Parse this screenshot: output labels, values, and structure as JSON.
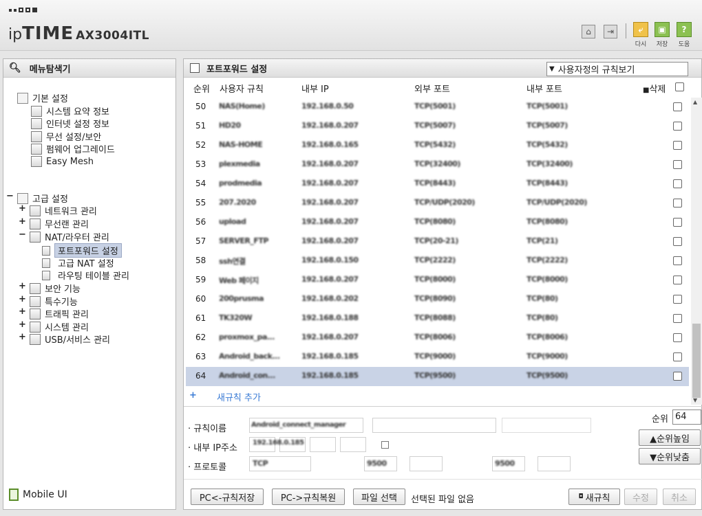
{
  "header": {
    "brand_ip": "ip",
    "brand_time": "TIME",
    "model": "AX3004ITL",
    "actions": [
      {
        "label": "다시",
        "icon": "restart-icon",
        "color": "#e0a020"
      },
      {
        "label": "저장",
        "icon": "save-icon",
        "color": "#6aa82f"
      },
      {
        "label": "도움",
        "icon": "help-icon",
        "color": "#6aa82f"
      }
    ],
    "help_glyph": "?"
  },
  "sidebar": {
    "title": "메뉴탐색기",
    "groups": [
      {
        "label": "기본 설정",
        "items": [
          "시스템 요약 정보",
          "인터넷 설정 정보",
          "무선 설정/보안",
          "펌웨어 업그레이드",
          "Easy Mesh"
        ]
      },
      {
        "label": "고급 설정",
        "items": [
          "네트워크 관리",
          "무선랜 관리",
          "NAT/라우터 관리",
          "보안 기능",
          "특수기능",
          "트래픽 관리",
          "시스템 관리",
          "USB/서비스 관리"
        ]
      }
    ],
    "nat_sub": [
      "포트포워드 설정",
      "고급 NAT 설정",
      "라우팅 테이블 관리"
    ],
    "mobile_ui": "Mobile UI"
  },
  "main": {
    "title": "포트포워드 설정",
    "view_select": "사용자정의 규칙보기",
    "columns": {
      "order": "순위",
      "rule": "사용자 규칙",
      "internal_ip": "내부 IP",
      "external_port": "외부 포트",
      "internal_port": "내부 포트",
      "delete": "삭제"
    },
    "rows": [
      {
        "n": "50",
        "rule": "NAS(Home)",
        "ip": "192.168.0.50",
        "ext": "TCP(5001)",
        "int": "TCP(5001)"
      },
      {
        "n": "51",
        "rule": "HD20",
        "ip": "192.168.0.207",
        "ext": "TCP(5007)",
        "int": "TCP(5007)"
      },
      {
        "n": "52",
        "rule": "NAS-HOME",
        "ip": "192.168.0.165",
        "ext": "TCP(5432)",
        "int": "TCP(5432)"
      },
      {
        "n": "53",
        "rule": "plexmedia",
        "ip": "192.168.0.207",
        "ext": "TCP(32400)",
        "int": "TCP(32400)"
      },
      {
        "n": "54",
        "rule": "prodmedia",
        "ip": "192.168.0.207",
        "ext": "TCP(8443)",
        "int": "TCP(8443)"
      },
      {
        "n": "55",
        "rule": "207.2020",
        "ip": "192.168.0.207",
        "ext": "TCP/UDP(2020)",
        "int": "TCP/UDP(2020)"
      },
      {
        "n": "56",
        "rule": "upload",
        "ip": "192.168.0.207",
        "ext": "TCP(8080)",
        "int": "TCP(8080)"
      },
      {
        "n": "57",
        "rule": "SERVER_FTP",
        "ip": "192.168.0.207",
        "ext": "TCP(20-21)",
        "int": "TCP(21)"
      },
      {
        "n": "58",
        "rule": "ssh연결",
        "ip": "192.168.0.150",
        "ext": "TCP(2222)",
        "int": "TCP(2222)"
      },
      {
        "n": "59",
        "rule": "Web 페이지",
        "ip": "192.168.0.207",
        "ext": "TCP(8000)",
        "int": "TCP(8000)"
      },
      {
        "n": "60",
        "rule": "200prusma",
        "ip": "192.168.0.202",
        "ext": "TCP(8090)",
        "int": "TCP(80)"
      },
      {
        "n": "61",
        "rule": "TK320W",
        "ip": "192.168.0.188",
        "ext": "TCP(8088)",
        "int": "TCP(80)"
      },
      {
        "n": "62",
        "rule": "proxmox_pa...",
        "ip": "192.168.0.207",
        "ext": "TCP(8006)",
        "int": "TCP(8006)"
      },
      {
        "n": "63",
        "rule": "Android_back...",
        "ip": "192.168.0.185",
        "ext": "TCP(9000)",
        "int": "TCP(9000)"
      },
      {
        "n": "64",
        "rule": "Android_con...",
        "ip": "192.168.0.185",
        "ext": "TCP(9500)",
        "int": "TCP(9500)"
      }
    ],
    "add_rule": "새규칙 추가",
    "form": {
      "rule_name_label": "규칙이름",
      "internal_ip_label": "내부 IP주소",
      "protocol_label": "프로토콜",
      "order_label": "순위",
      "order_value": "64",
      "rule_name_value": "Android_connect_manager",
      "internal_ip_value": "192.168.0.185",
      "protocol_value": "TCP",
      "ext_port_value": "9500",
      "int_port_value": "9500",
      "up_label": "▲순위높임",
      "down_label": "▼순위낮춤"
    },
    "buttons": {
      "save_pc": "PC<-규칙저장",
      "restore_pc": "PC->규칙복원",
      "file_select": "파일 선택",
      "no_file": "선택된 파일 없음",
      "new_rule": "새규칙",
      "modify": "수정",
      "cancel": "취소"
    },
    "selected_row": "64"
  }
}
